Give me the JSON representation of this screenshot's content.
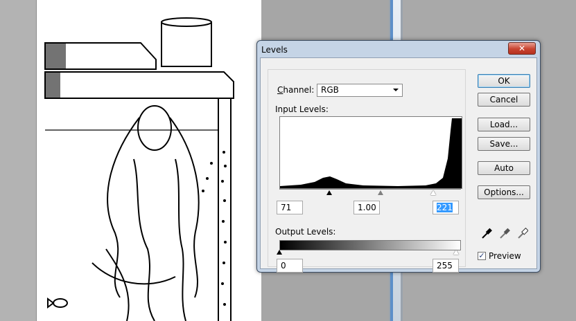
{
  "dialog": {
    "title": "Levels",
    "close_symbol": "✕",
    "channel_label": "Channel:",
    "channel_value": "RGB",
    "input_levels_label": "Input Levels:",
    "input_black": "71",
    "input_gamma": "1.00",
    "input_white": "221",
    "output_levels_label": "Output Levels:",
    "output_black": "0",
    "output_white": "255",
    "buttons": {
      "ok": "OK",
      "cancel": "Cancel",
      "load": "Load...",
      "save": "Save...",
      "auto": "Auto",
      "options": "Options..."
    },
    "preview_label": "Preview",
    "preview_checked": true,
    "eyedroppers": [
      "black-eyedropper-icon",
      "gray-eyedropper-icon",
      "white-eyedropper-icon"
    ]
  }
}
